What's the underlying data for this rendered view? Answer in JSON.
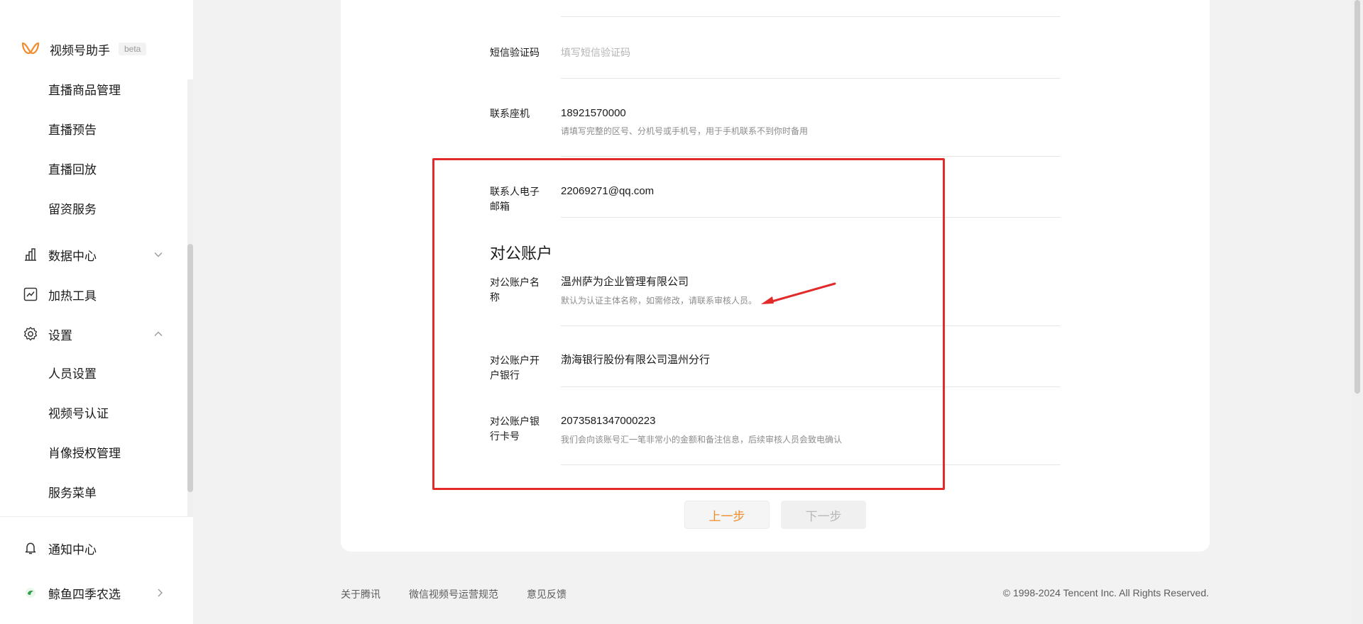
{
  "sidebar": {
    "brand_name": "视频号助手",
    "brand_badge": "beta",
    "live_items": [
      "直播商品管理",
      "直播预告",
      "直播回放",
      "留资服务"
    ],
    "data_center": "数据中心",
    "boost_tools": "加热工具",
    "settings": "设置",
    "settings_items": [
      "人员设置",
      "视频号认证",
      "肖像授权管理",
      "服务菜单"
    ],
    "notification_center": "通知中心",
    "account_name": "鲸鱼四季农选"
  },
  "form": {
    "sms_label": "短信验证码",
    "sms_placeholder": "填写短信验证码",
    "landline_label": "联系座机",
    "landline_value": "18921570000",
    "landline_hint": "请填写完整的区号、分机号或手机号，用于手机联系不到你时备用",
    "email_label": "联系人电子邮箱",
    "email_value": "22069271@qq.com",
    "section_title": "对公账户",
    "account_name_label": "对公账户名称",
    "account_name_value": "温州萨为企业管理有限公司",
    "account_name_hint": "默认为认证主体名称，如需修改，请联系审核人员。",
    "bank_label": "对公账户开户银行",
    "bank_value": "渤海银行股份有限公司温州分行",
    "card_label": "对公账户银行卡号",
    "card_value": "2073581347000223",
    "card_hint": "我们会向该账号汇一笔非常小的金额和备注信息，后续审核人员会致电确认"
  },
  "buttons": {
    "prev": "上一步",
    "next": "下一步"
  },
  "footer": {
    "about": "关于腾讯",
    "rules": "微信视频号运营规范",
    "feedback": "意见反馈",
    "copyright": "© 1998-2024 Tencent Inc. All Rights Reserved."
  },
  "colors": {
    "accent": "#f08c2c",
    "highlight": "#e32a2a"
  }
}
